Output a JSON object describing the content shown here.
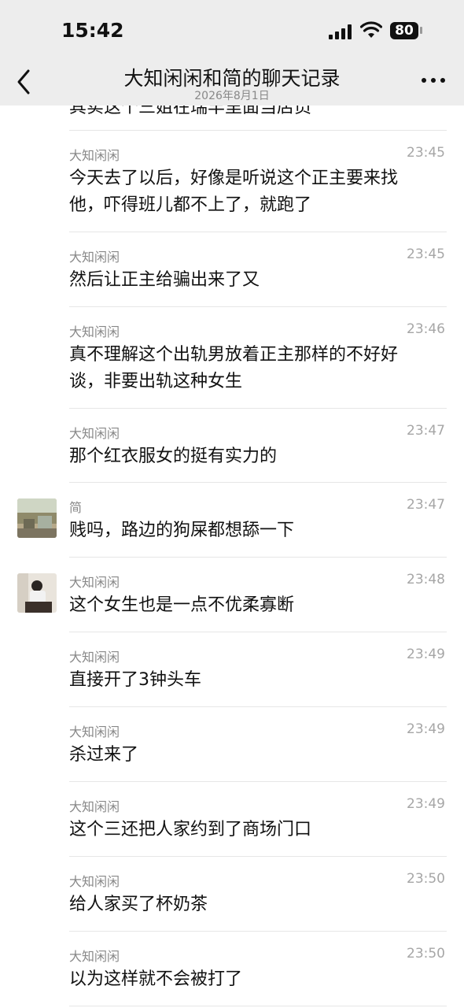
{
  "status_bar": {
    "time": "15:42",
    "battery": "80"
  },
  "header": {
    "title": "大知闲闲和简的聊天记录",
    "date": "2026年8月1日"
  },
  "partial_text": "其实这个三姐在瑞丰里面当店员",
  "messages": [
    {
      "sender": "大知闲闲",
      "time": "23:45",
      "text": "今天去了以后，好像是听说这个正主要来找他，吓得班儿都不上了，就跑了"
    },
    {
      "sender": "大知闲闲",
      "time": "23:45",
      "text": "然后让正主给骗出来了又"
    },
    {
      "sender": "大知闲闲",
      "time": "23:46",
      "text": "真不理解这个出轨男放着正主那样的不好好谈，非要出轨这种女生"
    },
    {
      "sender": "大知闲闲",
      "time": "23:47",
      "text": "那个红衣服女的挺有实力的"
    },
    {
      "sender": "简",
      "time": "23:47",
      "text": "贱吗，路边的狗屎都想舔一下"
    },
    {
      "sender": "大知闲闲",
      "time": "23:48",
      "text": "这个女生也是一点不优柔寡断"
    },
    {
      "sender": "大知闲闲",
      "time": "23:49",
      "text": "直接开了3钟头车"
    },
    {
      "sender": "大知闲闲",
      "time": "23:49",
      "text": "杀过来了"
    },
    {
      "sender": "大知闲闲",
      "time": "23:49",
      "text": "这个三还把人家约到了商场门口"
    },
    {
      "sender": "大知闲闲",
      "time": "23:50",
      "text": "给人家买了杯奶茶"
    },
    {
      "sender": "大知闲闲",
      "time": "23:50",
      "text": "以为这样就不会被打了"
    }
  ]
}
